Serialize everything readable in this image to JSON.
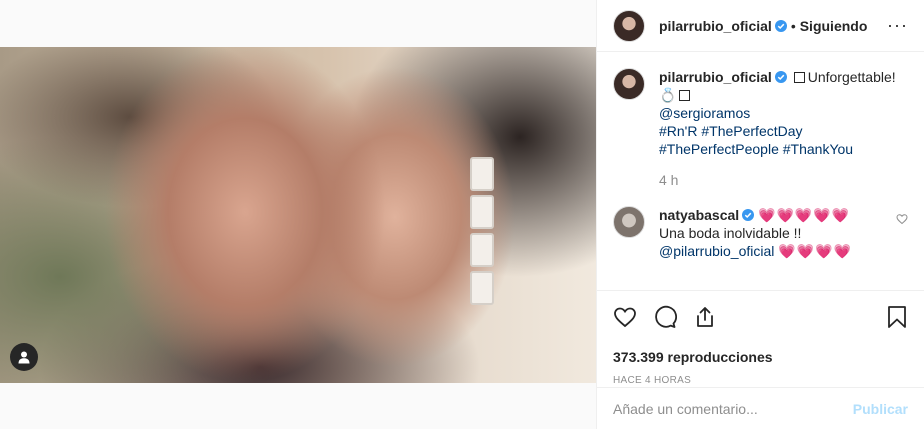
{
  "post": {
    "author": "pilarrubio_oficial",
    "follow_status": "Siguiendo",
    "dot": "•",
    "more": "···"
  },
  "caption": {
    "author": "pilarrubio_oficial",
    "text": "Unforgettable!",
    "emoji_ring": "💍",
    "mention": "@sergioramos",
    "hashtags_line1": "#Rn'R #ThePerfectDay",
    "hashtags_line2": "#ThePerfectPeople #ThankYou",
    "time": "4 h"
  },
  "comment": {
    "author": "natyabascal",
    "hearts": "💗💗💗💗💗",
    "text": "Una boda inolvidable !!",
    "mention": "@pilarrubio_oficial",
    "hearts_after": "💗💗💗💗"
  },
  "stats": {
    "views": "373.399 reproducciones",
    "posted": "HACE 4 HORAS"
  },
  "add_comment": {
    "placeholder": "Añade un comentario...",
    "publish": "Publicar"
  },
  "icons": {
    "like": "heart-icon",
    "comment": "comment-icon",
    "share": "share-icon",
    "save": "bookmark-icon",
    "tag": "user-tag-icon",
    "verified": "verified-badge-icon"
  },
  "colors": {
    "verified": "#3897f0",
    "link": "#003569",
    "muted": "#8e8e8e",
    "publish_disabled": "#b2dffc",
    "hearts": "#ed4ca0"
  }
}
